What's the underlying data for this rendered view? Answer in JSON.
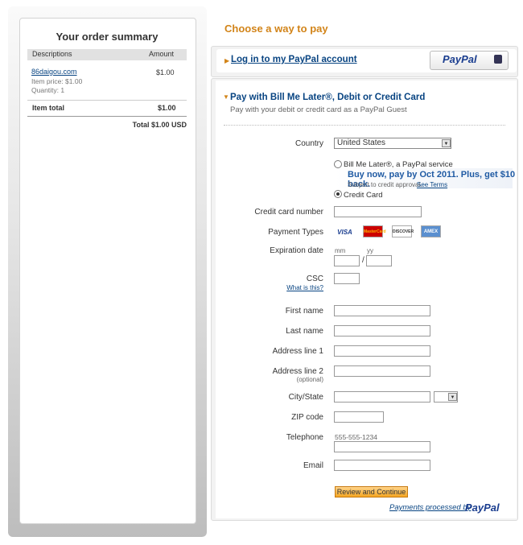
{
  "summary": {
    "title": "Your order summary",
    "col_desc": "Descriptions",
    "col_amount": "Amount",
    "item_name": "86daigou.com",
    "item_price": "Item price: $1.00",
    "item_qty": "Quantity: 1",
    "item_amount": "$1.00",
    "item_total_label": "Item total",
    "item_total_value": "$1.00",
    "total_line": "Total $1.00 USD"
  },
  "header": {
    "choose_title": "Choose a way to pay",
    "login_link": "Log in to my PayPal account",
    "paypal_badge": "PayPal"
  },
  "bml": {
    "title": "Pay with Bill Me Later®, Debit or Credit Card",
    "subtitle": "Pay with your debit or credit card as a PayPal Guest"
  },
  "form": {
    "country_label": "Country",
    "country_value": "United States",
    "option_bml": "Bill Me Later®, a PayPal service",
    "promo_text": "Buy now, pay by Oct 2011. Plus, get $10 back.",
    "promo_sub": "Subject to credit approval.",
    "see_terms": "See Terms",
    "option_cc": "Credit Card",
    "cc_label": "Credit card number",
    "payment_types_label": "Payment Types",
    "card_types": [
      "VISA",
      "MasterCard",
      "DISCOVER",
      "AMEX"
    ],
    "exp_label": "Expiration date",
    "mm": "mm",
    "yy": "yy",
    "slash": "/",
    "csc_label": "CSC",
    "csc_help": "What is this?",
    "first_name_label": "First name",
    "last_name_label": "Last name",
    "addr1_label": "Address line 1",
    "addr2_label": "Address line 2",
    "optional": "(optional)",
    "city_label": "City/State",
    "zip_label": "ZIP code",
    "phone_label": "Telephone",
    "phone_placeholder": "555-555-1234",
    "email_label": "Email",
    "review_button": "Review and Continue",
    "processed_by": "Payments processed by",
    "processed_pp": "PayPal"
  }
}
